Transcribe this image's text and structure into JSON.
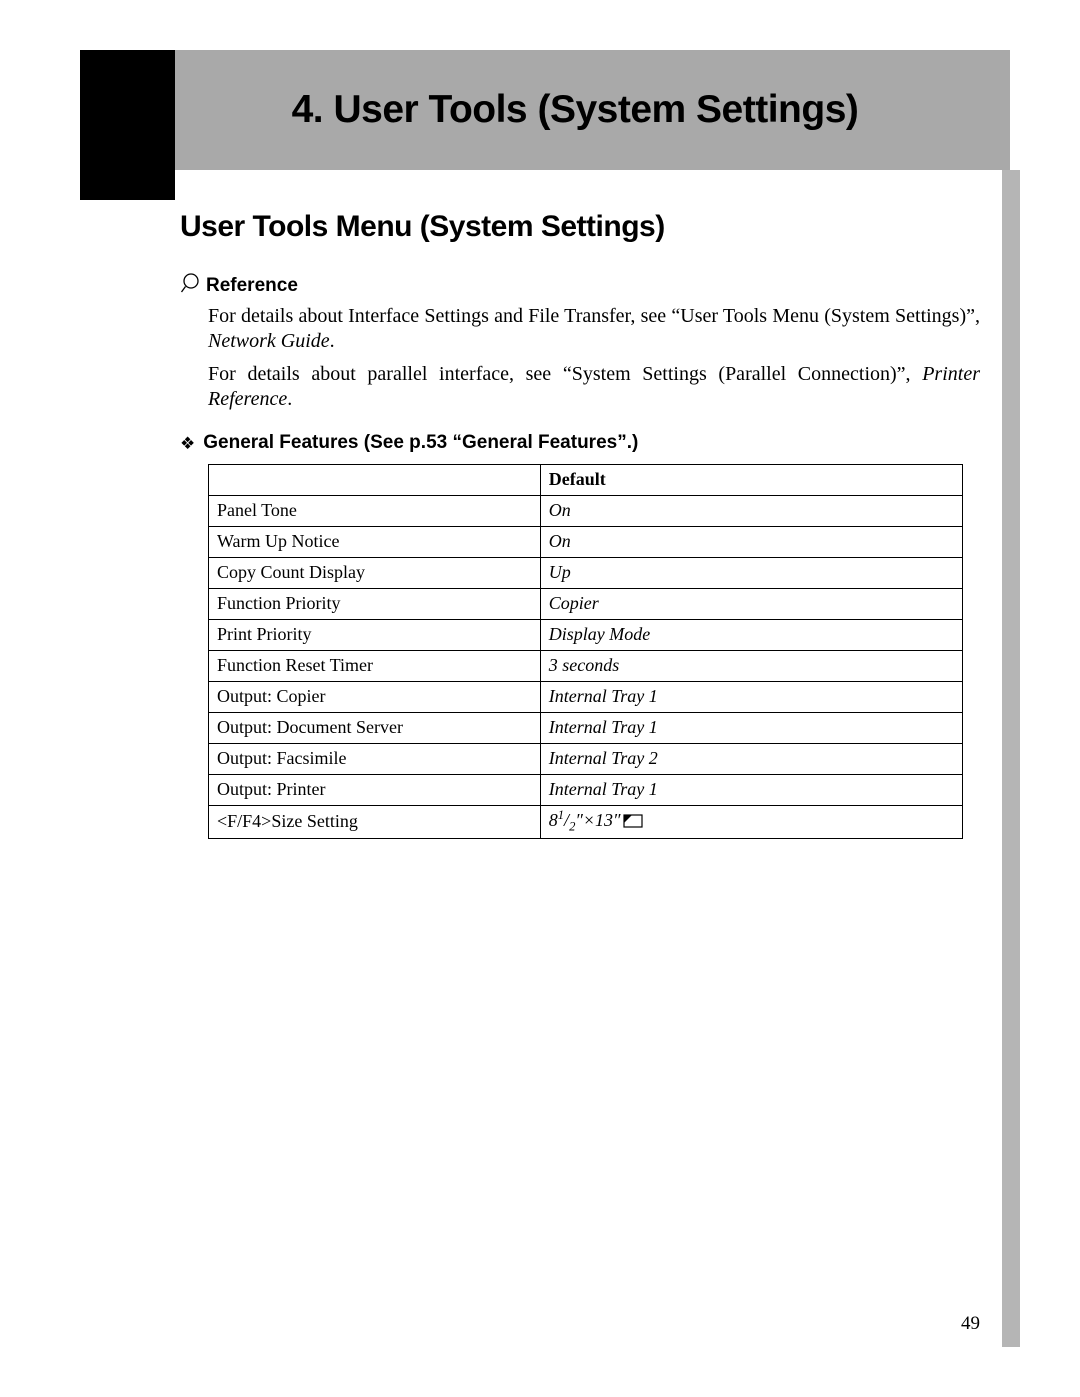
{
  "chapter_title": "4. User Tools (System Settings)",
  "section_title": "User Tools Menu (System Settings)",
  "reference": {
    "label": "Reference",
    "para1_a": "For details about Interface Settings and File Transfer, see “User Tools Menu (System Settings)”, ",
    "para1_ital": "Network Guide",
    "para1_b": ".",
    "para2_a": "For details about parallel interface, see “System Settings (Parallel Connection)”, ",
    "para2_ital": "Printer Reference",
    "para2_b": "."
  },
  "subhead": "General Features (See p.53 “General Features”.)",
  "table": {
    "header_empty": "",
    "header_default": "Default",
    "rows": [
      {
        "name": "Panel Tone",
        "default": "On"
      },
      {
        "name": "Warm Up Notice",
        "default": "On"
      },
      {
        "name": "Copy Count Display",
        "default": "Up"
      },
      {
        "name": "Function Priority",
        "default": "Copier"
      },
      {
        "name": "Print Priority",
        "default": "Display Mode"
      },
      {
        "name": "Function Reset Timer",
        "default": "3 seconds"
      },
      {
        "name": "Output: Copier",
        "default": "Internal Tray 1"
      },
      {
        "name": "Output: Document Server",
        "default": "Internal Tray 1"
      },
      {
        "name": "Output: Facsimile",
        "default": "Internal Tray 2"
      },
      {
        "name": "Output: Printer",
        "default": "Internal Tray 1"
      },
      {
        "name": "<F/F4>Size Setting",
        "default_special": true
      }
    ]
  },
  "size_setting_value": {
    "prefix": "8",
    "sup": "1",
    "sub": "2",
    "mid": "″×13″"
  },
  "page_number": "49"
}
